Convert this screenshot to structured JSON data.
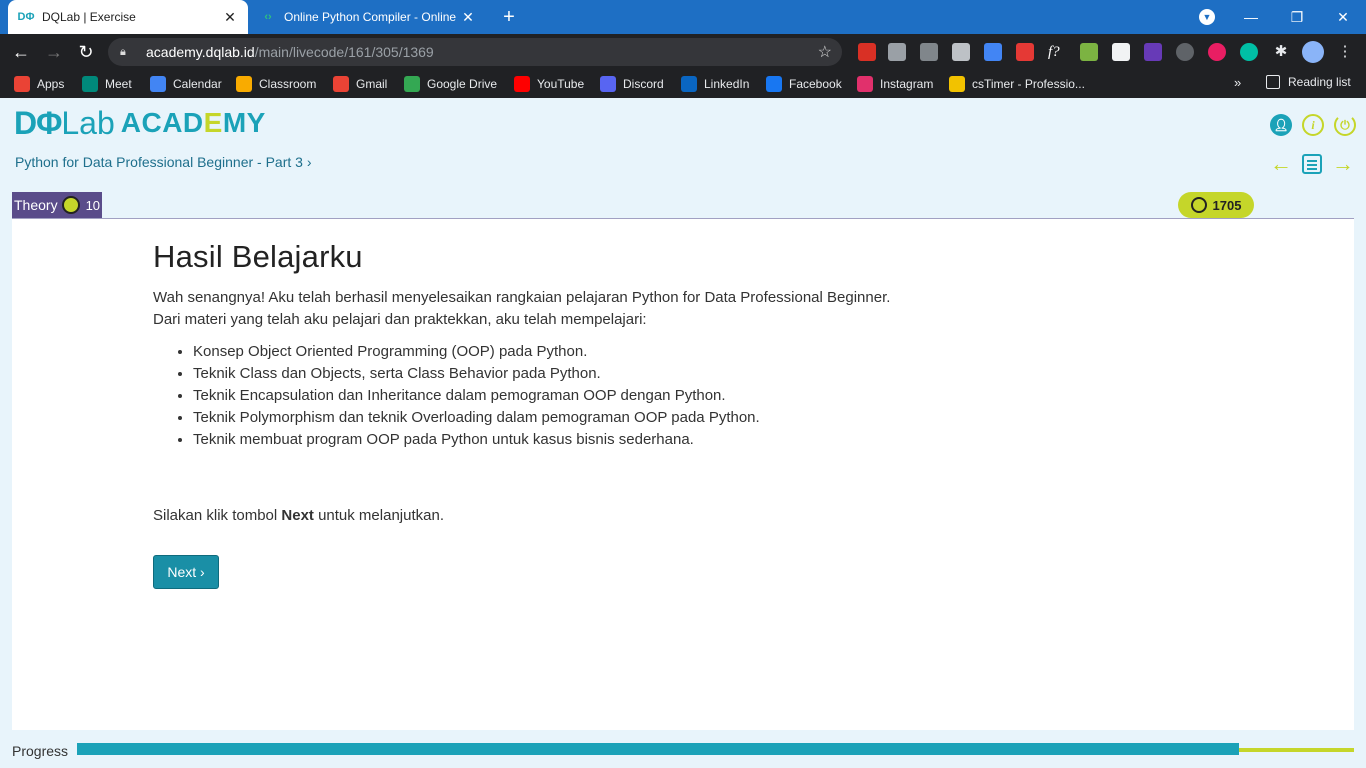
{
  "browser": {
    "tabs": [
      {
        "title": "DQLab | Exercise",
        "favicon": "DΦ",
        "active": true
      },
      {
        "title": "Online Python Compiler - Online",
        "favicon": "‹›",
        "active": false
      }
    ],
    "url_host": "academy.dqlab.id",
    "url_path": "/main/livecode/161/305/1369",
    "bookmarks": [
      {
        "label": "Apps",
        "icon_color": "#ea4335"
      },
      {
        "label": "Meet",
        "icon_color": "#00897b"
      },
      {
        "label": "Calendar",
        "icon_color": "#4285f4"
      },
      {
        "label": "Classroom",
        "icon_color": "#f9ab00"
      },
      {
        "label": "Gmail",
        "icon_color": "#ea4335"
      },
      {
        "label": "Google Drive",
        "icon_color": "#34a853"
      },
      {
        "label": "YouTube",
        "icon_color": "#ff0000"
      },
      {
        "label": "Discord",
        "icon_color": "#5865f2"
      },
      {
        "label": "LinkedIn",
        "icon_color": "#0a66c2"
      },
      {
        "label": "Facebook",
        "icon_color": "#1877f2"
      },
      {
        "label": "Instagram",
        "icon_color": "#e1306c"
      },
      {
        "label": "csTimer - Professio...",
        "icon_color": "#f2c200"
      }
    ],
    "bookmarks_more": "»",
    "reading_list": "Reading list"
  },
  "header": {
    "logo_dq": "DΦ",
    "logo_lab": "Lab",
    "logo_academy_a": "ACAD",
    "logo_academy_e": "E",
    "logo_academy_b": "MY",
    "breadcrumb": "Python for Data Professional Beginner - Part 3 ›"
  },
  "theory": {
    "label": "Theory",
    "points": "10"
  },
  "score": "1705",
  "lesson": {
    "title": "Hasil Belajarku",
    "intro_1": "Wah senangnya! Aku telah berhasil menyelesaikan rangkaian pelajaran Python for Data Professional Beginner.",
    "intro_2": "Dari materi yang telah aku pelajari dan praktekkan, aku telah mempelajari:",
    "items": [
      "Konsep Object Oriented Programming (OOP) pada Python.",
      "Teknik Class dan Objects, serta Class Behavior pada Python.",
      "Teknik Encapsulation dan Inheritance dalam pemograman OOP dengan Python.",
      "Teknik Polymorphism dan teknik Overloading dalam pemograman OOP pada Python.",
      "Teknik membuat program OOP pada Python untuk kasus bisnis sederhana."
    ],
    "cta_before": "Silakan klik tombol ",
    "cta_bold": "Next",
    "cta_after": " untuk melanjutkan.",
    "next_label": "Next ›"
  },
  "progress": {
    "label": "Progress",
    "fraction": 0.91
  },
  "colors": {
    "brand_teal": "#1ba2b8",
    "brand_lime": "#c5d62a",
    "theory_purple": "#5a4c8a"
  }
}
